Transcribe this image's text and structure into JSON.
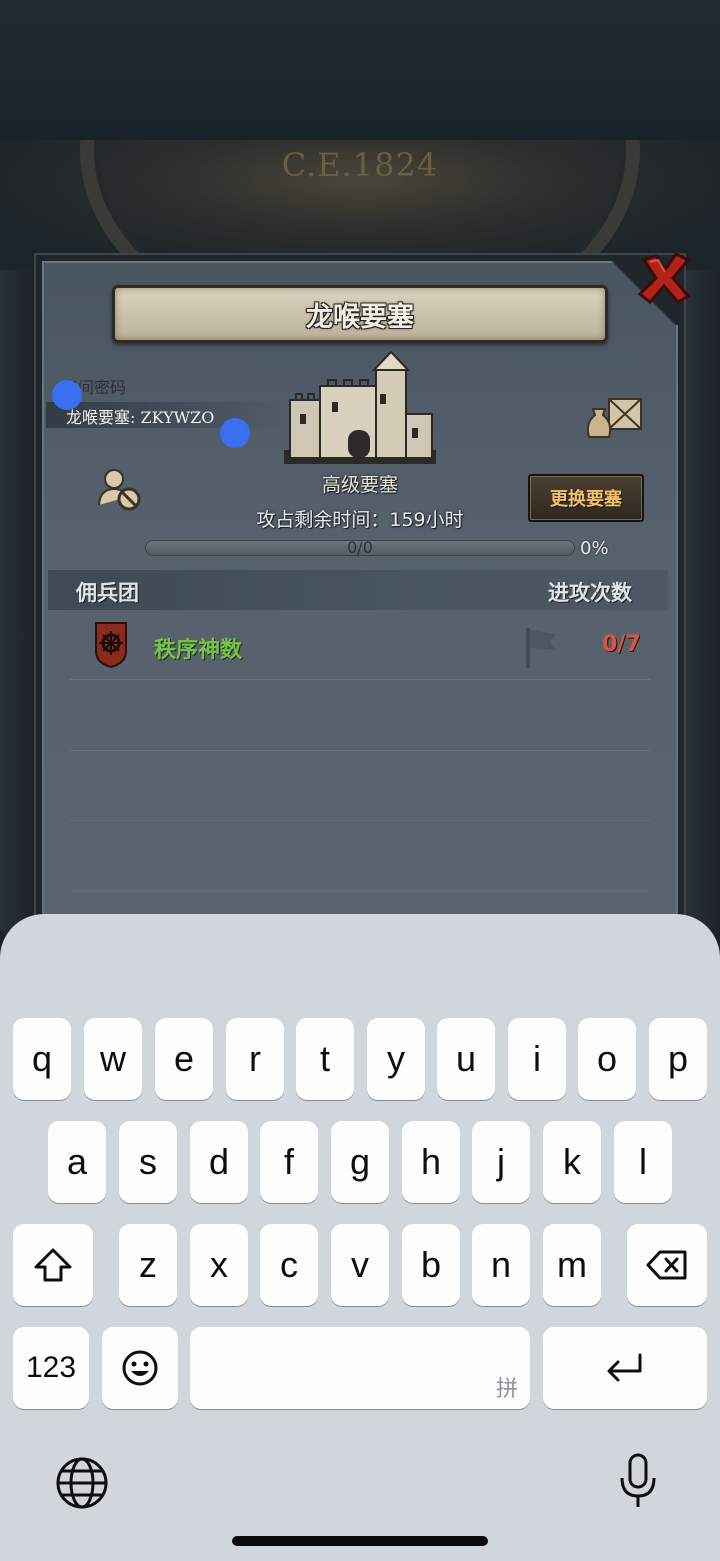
{
  "game": {
    "year": "C.E.1824",
    "fortress_title": "龙喉要塞",
    "room_label": "房间密码",
    "room_code": "龙喉要塞: ZKYWZO",
    "fortress_level": "高级要塞",
    "time_remaining": "攻占剩余时间：159小时",
    "progress_count": "0/0",
    "progress_percent": "0%",
    "progress_value": 0,
    "change_button": "更换要塞",
    "section": {
      "left_header": "佣兵团",
      "right_header": "进攻次数"
    },
    "mercenaries": [
      {
        "name": "秩序神数",
        "attacks": "0/7",
        "name_color": "#79c24a",
        "count_color": "#d8563f"
      }
    ]
  },
  "keyboard": {
    "row1": [
      "q",
      "w",
      "e",
      "r",
      "t",
      "y",
      "u",
      "i",
      "o",
      "p"
    ],
    "row2": [
      "a",
      "s",
      "d",
      "f",
      "g",
      "h",
      "j",
      "k",
      "l"
    ],
    "row3": [
      "z",
      "x",
      "c",
      "v",
      "b",
      "n",
      "m"
    ],
    "numbers_key": "123",
    "space_hint": "拼",
    "icons": [
      "shift-icon",
      "delete-icon",
      "emoji-icon",
      "return-icon",
      "globe-icon",
      "microphone-icon"
    ]
  }
}
